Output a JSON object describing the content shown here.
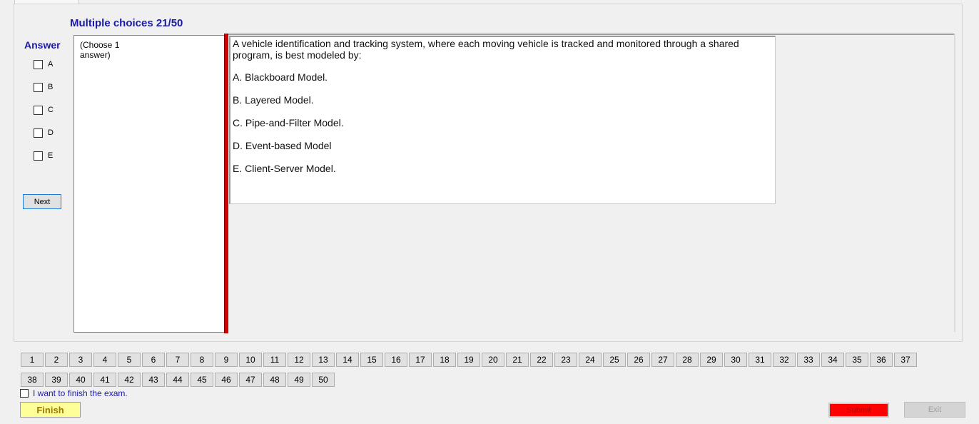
{
  "header": {
    "title": "Multiple choices 21/50"
  },
  "answer": {
    "label": "Answer",
    "options": [
      "A",
      "B",
      "C",
      "D",
      "E"
    ],
    "next_label": "Next"
  },
  "instructions": {
    "text_line1": "(Choose 1",
    "text_line2": "answer)"
  },
  "question": {
    "text": "A vehicle identification and tracking system, where each moving vehicle is tracked and monitored through a shared program, is best modeled by:",
    "choices": [
      "A.  Blackboard Model.",
      "B.  Layered Model.",
      "C.  Pipe-and-Filter Model.",
      "D.  Event-based Model",
      "E.  Client-Server Model."
    ]
  },
  "navigation": {
    "row1": [
      "1",
      "2",
      "3",
      "4",
      "5",
      "6",
      "7",
      "8",
      "9",
      "10",
      "11",
      "12",
      "13",
      "14",
      "15",
      "16",
      "17",
      "18",
      "19",
      "20",
      "21",
      "22",
      "23",
      "24",
      "25",
      "26",
      "27",
      "28",
      "29",
      "30",
      "31",
      "32",
      "33",
      "34",
      "35",
      "36",
      "37"
    ],
    "row2": [
      "38",
      "39",
      "40",
      "41",
      "42",
      "43",
      "44",
      "45",
      "46",
      "47",
      "48",
      "49",
      "50"
    ]
  },
  "footer": {
    "finish_check_label": "I want to finish the exam.",
    "finish_label": "Finish",
    "submit_label": "Submit",
    "exit_label": "Exit"
  },
  "colors": {
    "accent_text": "#1a1aa8",
    "divider_red": "#d40000",
    "finish_bg": "#ffff99",
    "submit_bg": "#ff0000"
  }
}
